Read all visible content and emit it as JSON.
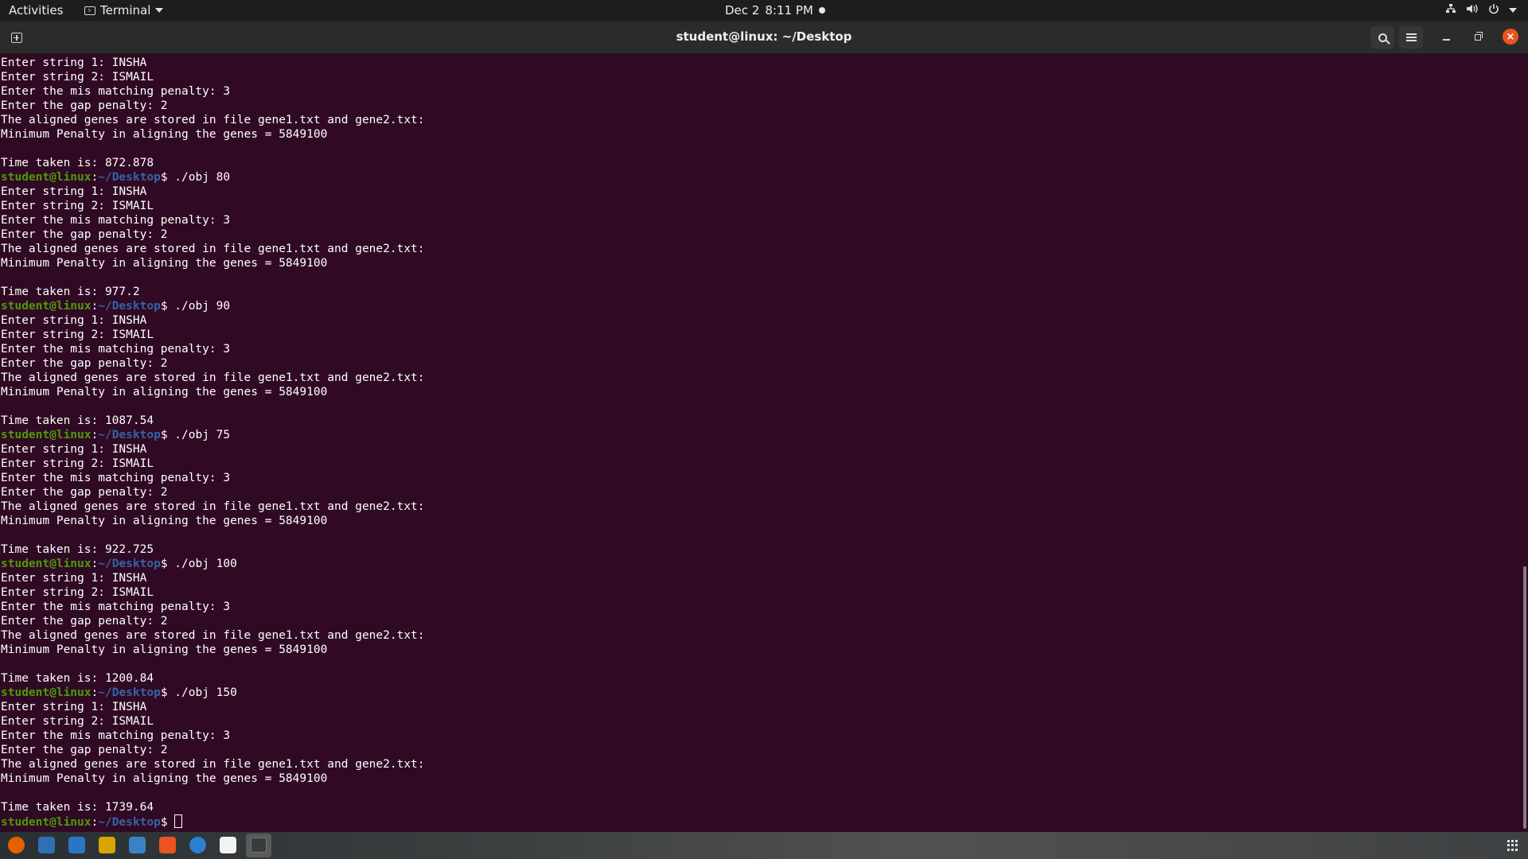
{
  "topbar": {
    "activities": "Activities",
    "app_name": "Terminal",
    "date": "Dec 2",
    "time": "8:11 PM",
    "tray_icons": [
      "network-icon",
      "volume-icon",
      "power-icon"
    ]
  },
  "window": {
    "title": "student@linux: ~/Desktop"
  },
  "prompt": {
    "user": "student@linux",
    "path": "~/Desktop"
  },
  "terminal": {
    "lines": [
      {
        "t": "Enter string 1: INSHA"
      },
      {
        "t": "Enter string 2: ISMAIL"
      },
      {
        "t": "Enter the mis matching penalty: 3"
      },
      {
        "t": "Enter the gap penalty: 2"
      },
      {
        "t": "The aligned genes are stored in file gene1.txt and gene2.txt:"
      },
      {
        "t": "Minimum Penalty in aligning the genes = 5849100"
      },
      {
        "t": ""
      },
      {
        "t": "Time taken is: 872.878"
      },
      {
        "p": "./obj 80"
      },
      {
        "t": "Enter string 1: INSHA"
      },
      {
        "t": "Enter string 2: ISMAIL"
      },
      {
        "t": "Enter the mis matching penalty: 3"
      },
      {
        "t": "Enter the gap penalty: 2"
      },
      {
        "t": "The aligned genes are stored in file gene1.txt and gene2.txt:"
      },
      {
        "t": "Minimum Penalty in aligning the genes = 5849100"
      },
      {
        "t": ""
      },
      {
        "t": "Time taken is: 977.2"
      },
      {
        "p": "./obj 90"
      },
      {
        "t": "Enter string 1: INSHA"
      },
      {
        "t": "Enter string 2: ISMAIL"
      },
      {
        "t": "Enter the mis matching penalty: 3"
      },
      {
        "t": "Enter the gap penalty: 2"
      },
      {
        "t": "The aligned genes are stored in file gene1.txt and gene2.txt:"
      },
      {
        "t": "Minimum Penalty in aligning the genes = 5849100"
      },
      {
        "t": ""
      },
      {
        "t": "Time taken is: 1087.54"
      },
      {
        "p": "./obj 75"
      },
      {
        "t": "Enter string 1: INSHA"
      },
      {
        "t": "Enter string 2: ISMAIL"
      },
      {
        "t": "Enter the mis matching penalty: 3"
      },
      {
        "t": "Enter the gap penalty: 2"
      },
      {
        "t": "The aligned genes are stored in file gene1.txt and gene2.txt:"
      },
      {
        "t": "Minimum Penalty in aligning the genes = 5849100"
      },
      {
        "t": ""
      },
      {
        "t": "Time taken is: 922.725"
      },
      {
        "p": "./obj 100"
      },
      {
        "t": "Enter string 1: INSHA"
      },
      {
        "t": "Enter string 2: ISMAIL"
      },
      {
        "t": "Enter the mis matching penalty: 3"
      },
      {
        "t": "Enter the gap penalty: 2"
      },
      {
        "t": "The aligned genes are stored in file gene1.txt and gene2.txt:"
      },
      {
        "t": "Minimum Penalty in aligning the genes = 5849100"
      },
      {
        "t": ""
      },
      {
        "t": "Time taken is: 1200.84"
      },
      {
        "p": "./obj 150"
      },
      {
        "t": "Enter string 1: INSHA"
      },
      {
        "t": "Enter string 2: ISMAIL"
      },
      {
        "t": "Enter the mis matching penalty: 3"
      },
      {
        "t": "Enter the gap penalty: 2"
      },
      {
        "t": "The aligned genes are stored in file gene1.txt and gene2.txt:"
      },
      {
        "t": "Minimum Penalty in aligning the genes = 5849100"
      },
      {
        "t": ""
      },
      {
        "t": "Time taken is: 1739.64"
      },
      {
        "p": "",
        "cursor": true
      }
    ]
  },
  "dock": {
    "apps": [
      {
        "name": "firefox-icon",
        "color": "#e66000"
      },
      {
        "name": "thunderbird-icon",
        "color": "#2f6fb6"
      },
      {
        "name": "libreoffice-writer-icon",
        "color": "#2a76c6"
      },
      {
        "name": "rhythmbox-icon",
        "color": "#d9a400"
      },
      {
        "name": "text-editor-icon",
        "color": "#3b82c4"
      },
      {
        "name": "software-center-icon",
        "color": "#e95420"
      },
      {
        "name": "help-icon",
        "color": "#2c7fd3"
      },
      {
        "name": "files-icon",
        "color": "#f2f2f2"
      },
      {
        "name": "terminal-icon",
        "color": "#3a3a3a",
        "active": true
      }
    ]
  },
  "colors": {
    "terminal_bg": "#300a24",
    "prompt_user": "#4e9a06",
    "prompt_path": "#3465a4",
    "close_button": "#e95420"
  }
}
